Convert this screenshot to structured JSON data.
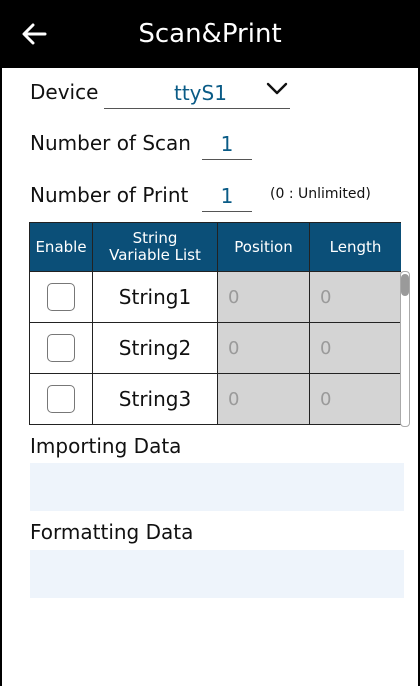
{
  "header": {
    "title": "Scan&Print",
    "back_icon": "back-arrow-icon"
  },
  "device": {
    "label": "Device",
    "value": "ttyS1"
  },
  "scan": {
    "label": "Number of Scan",
    "value": "1"
  },
  "print": {
    "label": "Number of Print",
    "value": "1",
    "hint": "(0 : Unlimited)"
  },
  "table": {
    "headers": {
      "enable": "Enable",
      "list_line1": "String",
      "list_line2": "Variable List",
      "position": "Position",
      "length": "Length"
    },
    "rows": [
      {
        "name": "String1",
        "position": "0",
        "length": "0",
        "enabled": false
      },
      {
        "name": "String2",
        "position": "0",
        "length": "0",
        "enabled": false
      },
      {
        "name": "String3",
        "position": "0",
        "length": "0",
        "enabled": false
      }
    ]
  },
  "importing": {
    "label": "Importing Data",
    "value": ""
  },
  "formatting": {
    "label": "Formatting Data",
    "value": ""
  },
  "colors": {
    "header_bg": "#000000",
    "table_header_bg": "#0b4f78",
    "accent": "#0a5b86",
    "readonly_bg": "#d4d4d4",
    "data_box_bg": "#eef4fb"
  }
}
